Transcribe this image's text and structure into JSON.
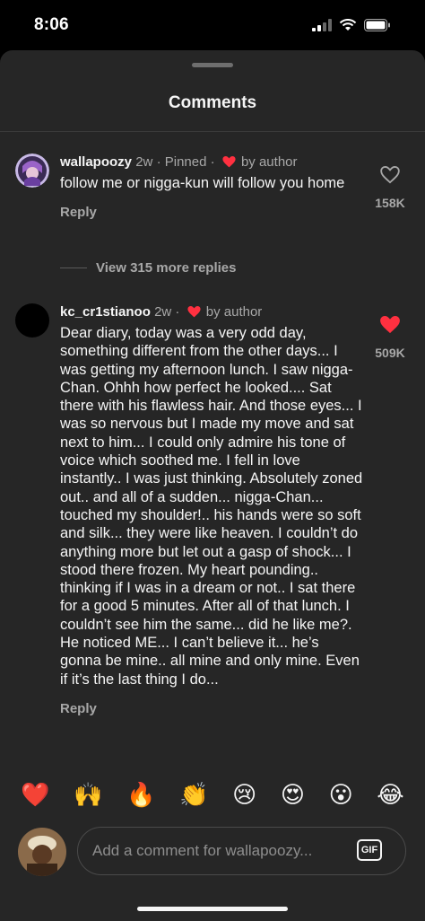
{
  "status_bar": {
    "time": "8:06"
  },
  "sheet": {
    "title": "Comments"
  },
  "comments": [
    {
      "username": "wallapoozy",
      "age": "2w",
      "pinned": "· Pinned ·",
      "by_author": "by author",
      "text": "follow me or nigga-kun will follow you home",
      "reply_label": "Reply",
      "like_count": "158K",
      "liked": false
    },
    {
      "username": "kc_cr1stianoo",
      "age": "2w",
      "separator": "·",
      "by_author": "by author",
      "text": "Dear diary, today was a very odd day, something different from the other days... I was getting my afternoon lunch. I saw nigga-Chan. Ohhh how perfect he looked.... Sat there with his flawless hair. And those eyes... I was so nervous but I made my move and sat next to him... I could only admire his tone of voice which soothed me. I fell in love instantly.. I was just thinking. Absolutely zoned out.. and all of a sudden... nigga-Chan... touched my shoulder!.. his hands were so soft and silk... they were like heaven. I couldn’t do anything more but let out a gasp of shock... I stood there frozen. My heart pounding.. thinking if I was in a dream or not.. I sat there for a good 5 minutes. After all of that lunch. I couldn’t see him the same... did he like me?. He noticed ME... I can’t believe it... he’s gonna be mine.. all mine and only mine. Even if it’s the last thing I do...",
      "reply_label": "Reply",
      "like_count": "509K",
      "liked": true
    }
  ],
  "view_replies": "View 315 more replies",
  "quick_reactions": [
    "❤️",
    "🙌",
    "🔥",
    "👏",
    "😢",
    "😍",
    "😮",
    "😂"
  ],
  "composer": {
    "placeholder": "Add a comment for wallapoozy...",
    "gif_label": "GIF"
  },
  "colors": {
    "sheet_bg": "#262626",
    "like_red": "#ff3040",
    "secondary_text": "#a8a8a8"
  }
}
